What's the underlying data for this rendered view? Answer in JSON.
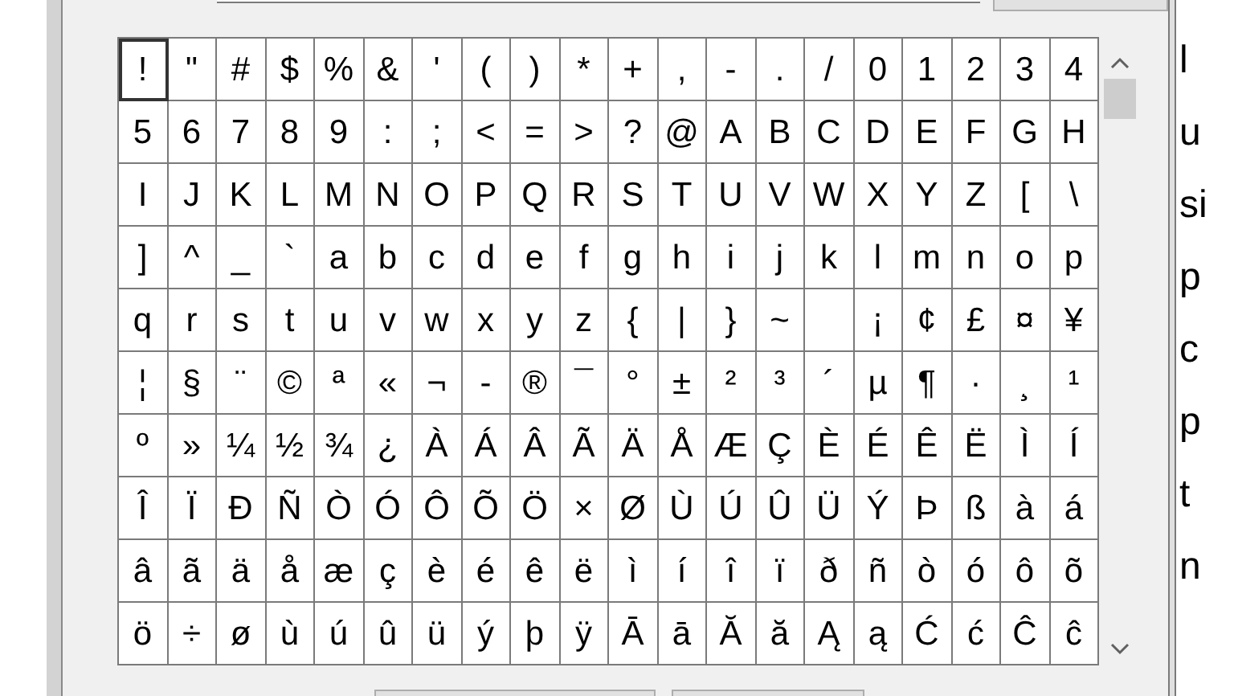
{
  "grid": {
    "rows": [
      [
        {
          "char": "!",
          "selected": true
        },
        {
          "char": "\"",
          "selected": false
        },
        {
          "char": "#",
          "selected": false
        },
        {
          "char": "$",
          "selected": false
        },
        {
          "char": "%",
          "selected": false
        },
        {
          "char": "&",
          "selected": false
        },
        {
          "char": "'",
          "selected": false
        },
        {
          "char": "(",
          "selected": false
        },
        {
          "char": ")",
          "selected": false
        },
        {
          "char": "*",
          "selected": false
        },
        {
          "char": "+",
          "selected": false
        },
        {
          "char": ",",
          "selected": false
        },
        {
          "char": "-",
          "selected": false
        },
        {
          "char": ".",
          "selected": false
        },
        {
          "char": "/",
          "selected": false
        },
        {
          "char": "0",
          "selected": false
        },
        {
          "char": "1",
          "selected": false
        },
        {
          "char": "2",
          "selected": false
        },
        {
          "char": "3",
          "selected": false
        },
        {
          "char": "4",
          "selected": false
        }
      ],
      [
        {
          "char": "5",
          "selected": false
        },
        {
          "char": "6",
          "selected": false
        },
        {
          "char": "7",
          "selected": false
        },
        {
          "char": "8",
          "selected": false
        },
        {
          "char": "9",
          "selected": false
        },
        {
          "char": ":",
          "selected": false
        },
        {
          "char": ";",
          "selected": false
        },
        {
          "char": "<",
          "selected": false
        },
        {
          "char": "=",
          "selected": false
        },
        {
          "char": ">",
          "selected": false
        },
        {
          "char": "?",
          "selected": false
        },
        {
          "char": "@",
          "selected": false
        },
        {
          "char": "A",
          "selected": false
        },
        {
          "char": "B",
          "selected": false
        },
        {
          "char": "C",
          "selected": false
        },
        {
          "char": "D",
          "selected": false
        },
        {
          "char": "E",
          "selected": false
        },
        {
          "char": "F",
          "selected": false
        },
        {
          "char": "G",
          "selected": false
        },
        {
          "char": "H",
          "selected": false
        }
      ],
      [
        {
          "char": "I",
          "selected": false
        },
        {
          "char": "J",
          "selected": false
        },
        {
          "char": "K",
          "selected": false
        },
        {
          "char": "L",
          "selected": false
        },
        {
          "char": "M",
          "selected": false
        },
        {
          "char": "N",
          "selected": false
        },
        {
          "char": "O",
          "selected": false
        },
        {
          "char": "P",
          "selected": false
        },
        {
          "char": "Q",
          "selected": false
        },
        {
          "char": "R",
          "selected": false
        },
        {
          "char": "S",
          "selected": false
        },
        {
          "char": "T",
          "selected": false
        },
        {
          "char": "U",
          "selected": false
        },
        {
          "char": "V",
          "selected": false
        },
        {
          "char": "W",
          "selected": false
        },
        {
          "char": "X",
          "selected": false
        },
        {
          "char": "Y",
          "selected": false
        },
        {
          "char": "Z",
          "selected": false
        },
        {
          "char": "[",
          "selected": false
        },
        {
          "char": "\\",
          "selected": false
        }
      ],
      [
        {
          "char": "]",
          "selected": false
        },
        {
          "char": "^",
          "selected": false
        },
        {
          "char": "_",
          "selected": false
        },
        {
          "char": "`",
          "selected": false
        },
        {
          "char": "a",
          "selected": false
        },
        {
          "char": "b",
          "selected": false
        },
        {
          "char": "c",
          "selected": false
        },
        {
          "char": "d",
          "selected": false
        },
        {
          "char": "e",
          "selected": false
        },
        {
          "char": "f",
          "selected": false
        },
        {
          "char": "g",
          "selected": false
        },
        {
          "char": "h",
          "selected": false
        },
        {
          "char": "i",
          "selected": false
        },
        {
          "char": "j",
          "selected": false
        },
        {
          "char": "k",
          "selected": false
        },
        {
          "char": "l",
          "selected": false
        },
        {
          "char": "m",
          "selected": false
        },
        {
          "char": "n",
          "selected": false
        },
        {
          "char": "o",
          "selected": false
        },
        {
          "char": "p",
          "selected": false
        }
      ],
      [
        {
          "char": "q",
          "selected": false
        },
        {
          "char": "r",
          "selected": false
        },
        {
          "char": "s",
          "selected": false
        },
        {
          "char": "t",
          "selected": false
        },
        {
          "char": "u",
          "selected": false
        },
        {
          "char": "v",
          "selected": false
        },
        {
          "char": "w",
          "selected": false
        },
        {
          "char": "x",
          "selected": false
        },
        {
          "char": "y",
          "selected": false
        },
        {
          "char": "z",
          "selected": false
        },
        {
          "char": "{",
          "selected": false
        },
        {
          "char": "|",
          "selected": false
        },
        {
          "char": "}",
          "selected": false
        },
        {
          "char": "~",
          "selected": false
        },
        {
          "selected": false
        },
        {
          "char": "¡",
          "selected": false
        },
        {
          "char": "¢",
          "selected": false
        },
        {
          "char": "£",
          "selected": false
        },
        {
          "char": "¤",
          "selected": false
        },
        {
          "char": "¥",
          "selected": false
        }
      ],
      [
        {
          "char": "¦",
          "selected": false
        },
        {
          "char": "§",
          "selected": false
        },
        {
          "char": "¨",
          "selected": false
        },
        {
          "char": "©",
          "selected": false
        },
        {
          "char": "ª",
          "selected": false
        },
        {
          "char": "«",
          "selected": false
        },
        {
          "char": "¬",
          "selected": false
        },
        {
          "char": "-",
          "selected": false
        },
        {
          "char": "®",
          "selected": false
        },
        {
          "char": "¯",
          "selected": false
        },
        {
          "char": "°",
          "selected": false
        },
        {
          "char": "±",
          "selected": false
        },
        {
          "char": "²",
          "selected": false
        },
        {
          "char": "³",
          "selected": false
        },
        {
          "char": "´",
          "selected": false
        },
        {
          "char": "µ",
          "selected": false
        },
        {
          "char": "¶",
          "selected": false
        },
        {
          "char": "·",
          "selected": false
        },
        {
          "char": "¸",
          "selected": false
        },
        {
          "char": "¹",
          "selected": false
        }
      ],
      [
        {
          "char": "º",
          "selected": false
        },
        {
          "char": "»",
          "selected": false
        },
        {
          "char": "¼",
          "selected": false
        },
        {
          "char": "½",
          "selected": false
        },
        {
          "char": "¾",
          "selected": false
        },
        {
          "char": "¿",
          "selected": false
        },
        {
          "char": "À",
          "selected": false
        },
        {
          "char": "Á",
          "selected": false
        },
        {
          "char": "Â",
          "selected": false
        },
        {
          "char": "Ã",
          "selected": false
        },
        {
          "char": "Ä",
          "selected": false
        },
        {
          "char": "Å",
          "selected": false
        },
        {
          "char": "Æ",
          "selected": false
        },
        {
          "char": "Ç",
          "selected": false
        },
        {
          "char": "È",
          "selected": false
        },
        {
          "char": "É",
          "selected": false
        },
        {
          "char": "Ê",
          "selected": false
        },
        {
          "char": "Ë",
          "selected": false
        },
        {
          "char": "Ì",
          "selected": false
        },
        {
          "char": "Í",
          "selected": false
        }
      ],
      [
        {
          "char": "Î",
          "selected": false
        },
        {
          "char": "Ï",
          "selected": false
        },
        {
          "char": "Ð",
          "selected": false
        },
        {
          "char": "Ñ",
          "selected": false
        },
        {
          "char": "Ò",
          "selected": false
        },
        {
          "char": "Ó",
          "selected": false
        },
        {
          "char": "Ô",
          "selected": false
        },
        {
          "char": "Õ",
          "selected": false
        },
        {
          "char": "Ö",
          "selected": false
        },
        {
          "char": "×",
          "selected": false
        },
        {
          "char": "Ø",
          "selected": false
        },
        {
          "char": "Ù",
          "selected": false
        },
        {
          "char": "Ú",
          "selected": false
        },
        {
          "char": "Û",
          "selected": false
        },
        {
          "char": "Ü",
          "selected": false
        },
        {
          "char": "Ý",
          "selected": false
        },
        {
          "char": "Þ",
          "selected": false
        },
        {
          "char": "ß",
          "selected": false
        },
        {
          "char": "à",
          "selected": false
        },
        {
          "char": "á",
          "selected": false
        }
      ],
      [
        {
          "char": "â",
          "selected": false
        },
        {
          "char": "ã",
          "selected": false
        },
        {
          "char": "ä",
          "selected": false
        },
        {
          "char": "å",
          "selected": false
        },
        {
          "char": "æ",
          "selected": false
        },
        {
          "char": "ç",
          "selected": false
        },
        {
          "char": "è",
          "selected": false
        },
        {
          "char": "é",
          "selected": false
        },
        {
          "char": "ê",
          "selected": false
        },
        {
          "char": "ë",
          "selected": false
        },
        {
          "char": "ì",
          "selected": false
        },
        {
          "char": "í",
          "selected": false
        },
        {
          "char": "î",
          "selected": false
        },
        {
          "char": "ï",
          "selected": false
        },
        {
          "char": "ð",
          "selected": false
        },
        {
          "char": "ñ",
          "selected": false
        },
        {
          "char": "ò",
          "selected": false
        },
        {
          "char": "ó",
          "selected": false
        },
        {
          "char": "ô",
          "selected": false
        },
        {
          "char": "õ",
          "selected": false
        }
      ],
      [
        {
          "char": "ö",
          "selected": false
        },
        {
          "char": "÷",
          "selected": false
        },
        {
          "char": "ø",
          "selected": false
        },
        {
          "char": "ù",
          "selected": false
        },
        {
          "char": "ú",
          "selected": false
        },
        {
          "char": "û",
          "selected": false
        },
        {
          "char": "ü",
          "selected": false
        },
        {
          "char": "ý",
          "selected": false
        },
        {
          "char": "þ",
          "selected": false
        },
        {
          "char": "ÿ",
          "selected": false
        },
        {
          "char": "Ā",
          "selected": false
        },
        {
          "char": "ā",
          "selected": false
        },
        {
          "char": "Ă",
          "selected": false
        },
        {
          "char": "ă",
          "selected": false
        },
        {
          "char": "Ą",
          "selected": false
        },
        {
          "char": "ą",
          "selected": false
        },
        {
          "char": "Ć",
          "selected": false
        },
        {
          "char": "ć",
          "selected": false
        },
        {
          "char": "Ĉ",
          "selected": false
        },
        {
          "char": "ĉ",
          "selected": false
        }
      ]
    ]
  },
  "background_text": [
    "l",
    "u",
    "si",
    "p",
    "c",
    "p",
    "t",
    "n"
  ]
}
